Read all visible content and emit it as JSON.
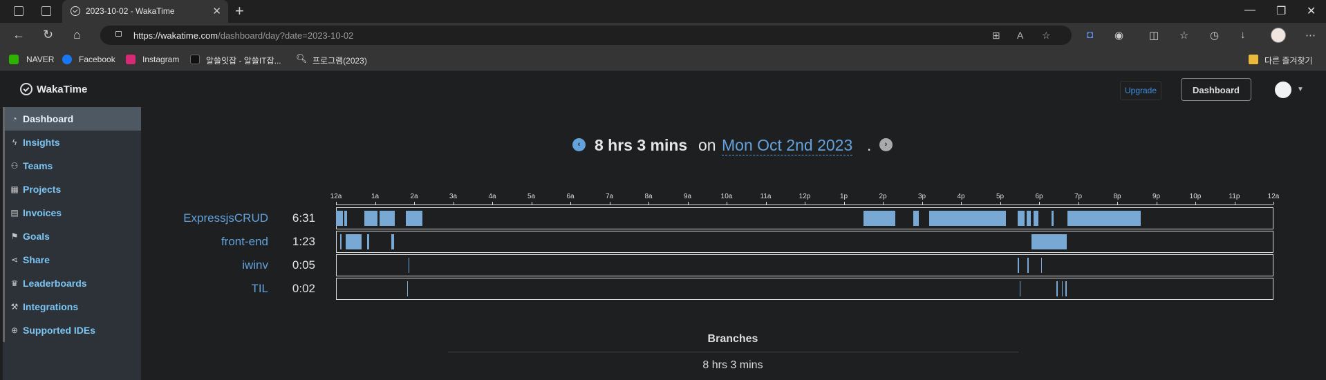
{
  "browser": {
    "tab_title": "2023-10-02 - WakaTime",
    "url_host": "https://wakatime.com",
    "url_path": "/dashboard/day?date=2023-10-02",
    "bookmarks": [
      "NAVER",
      "Facebook",
      "Instagram",
      "알쓸잇잡 - 알쓸IT잡...",
      "프로그램(2023)"
    ],
    "other_bookmarks": "다른 즐겨찾기"
  },
  "header": {
    "brand": "WakaTime",
    "upgrade_label": "Upgrade",
    "dashboard_label": "Dashboard"
  },
  "sidebar": {
    "items": [
      {
        "label": "Dashboard",
        "icon": "dashboard-icon",
        "active": true
      },
      {
        "label": "Insights",
        "icon": "bolt-icon"
      },
      {
        "label": "Teams",
        "icon": "users-icon"
      },
      {
        "label": "Projects",
        "icon": "grid-icon"
      },
      {
        "label": "Invoices",
        "icon": "file-icon"
      },
      {
        "label": "Goals",
        "icon": "flag-icon"
      },
      {
        "label": "Share",
        "icon": "share-icon"
      },
      {
        "label": "Leaderboards",
        "icon": "trophy-icon"
      },
      {
        "label": "Integrations",
        "icon": "wrench-icon"
      },
      {
        "label": "Supported IDEs",
        "icon": "plus-circle-icon"
      }
    ]
  },
  "summary": {
    "total": "8 hrs 3 mins",
    "on": "on",
    "date": "Mon Oct 2nd 2023",
    "period": "."
  },
  "timeline": {
    "ticks": [
      "12a",
      "1a",
      "2a",
      "3a",
      "4a",
      "5a",
      "6a",
      "7a",
      "8a",
      "9a",
      "10a",
      "11a",
      "12p",
      "1p",
      "2p",
      "3p",
      "4p",
      "5p",
      "6p",
      "7p",
      "8p",
      "9p",
      "10p",
      "11p",
      "12a"
    ],
    "bar_color": "#78a9d4",
    "projects": [
      {
        "name": "ExpressjsCRUD",
        "time": "6:31",
        "segments": [
          [
            0.0,
            0.18
          ],
          [
            0.22,
            0.28
          ],
          [
            0.72,
            1.07
          ],
          [
            1.11,
            1.51
          ],
          [
            1.78,
            2.22
          ],
          [
            13.5,
            14.32
          ],
          [
            14.78,
            14.92
          ],
          [
            15.18,
            17.15
          ],
          [
            17.45,
            17.62
          ],
          [
            17.68,
            17.78
          ],
          [
            17.85,
            17.98
          ],
          [
            18.32,
            18.38
          ],
          [
            18.72,
            20.6
          ]
        ]
      },
      {
        "name": "front-end",
        "time": "1:23",
        "segments": [
          [
            0.1,
            0.15
          ],
          [
            0.25,
            0.65
          ],
          [
            0.8,
            0.85
          ],
          [
            1.42,
            1.48
          ],
          [
            17.8,
            18.7
          ]
        ]
      },
      {
        "name": "iwinv",
        "time": "0:05",
        "segments": [
          [
            1.85,
            1.88
          ],
          [
            17.45,
            17.48
          ],
          [
            17.7,
            17.72
          ],
          [
            18.05,
            18.07
          ]
        ]
      },
      {
        "name": "TIL",
        "time": "0:02",
        "segments": [
          [
            1.82,
            1.84
          ],
          [
            17.5,
            17.52
          ],
          [
            18.45,
            18.48
          ],
          [
            18.58,
            18.6
          ],
          [
            18.68,
            18.7
          ]
        ]
      }
    ]
  },
  "branches": {
    "title": "Branches",
    "total": "8 hrs 3 mins"
  }
}
